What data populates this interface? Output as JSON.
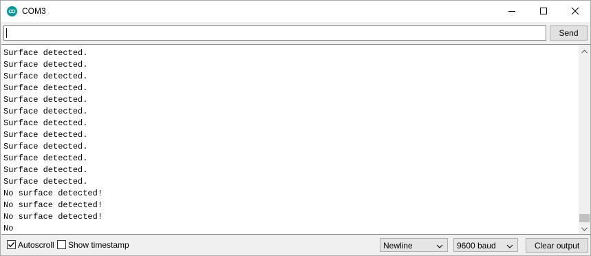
{
  "window": {
    "title": "COM3",
    "app_icon": "arduino-infinity-icon",
    "controls": [
      "minimize-icon",
      "maximize-icon",
      "close-icon"
    ]
  },
  "input": {
    "value": "",
    "send_label": "Send"
  },
  "output": {
    "lines": [
      "Surface detected.",
      "Surface detected.",
      "Surface detected.",
      "Surface detected.",
      "Surface detected.",
      "Surface detected.",
      "Surface detected.",
      "Surface detected.",
      "Surface detected.",
      "Surface detected.",
      "Surface detected.",
      "Surface detected.",
      "No surface detected!",
      "No surface detected!",
      "No surface detected!",
      "No"
    ]
  },
  "statusbar": {
    "autoscroll": {
      "label": "Autoscroll",
      "checked": true
    },
    "show_timestamp": {
      "label": "Show timestamp",
      "checked": false
    },
    "line_ending": "Newline",
    "baud_rate": "9600 baud",
    "clear_label": "Clear output"
  },
  "colors": {
    "accent": "#00979c",
    "window_bg": "#f0f0f0",
    "button_bg": "#e1e1e1"
  }
}
